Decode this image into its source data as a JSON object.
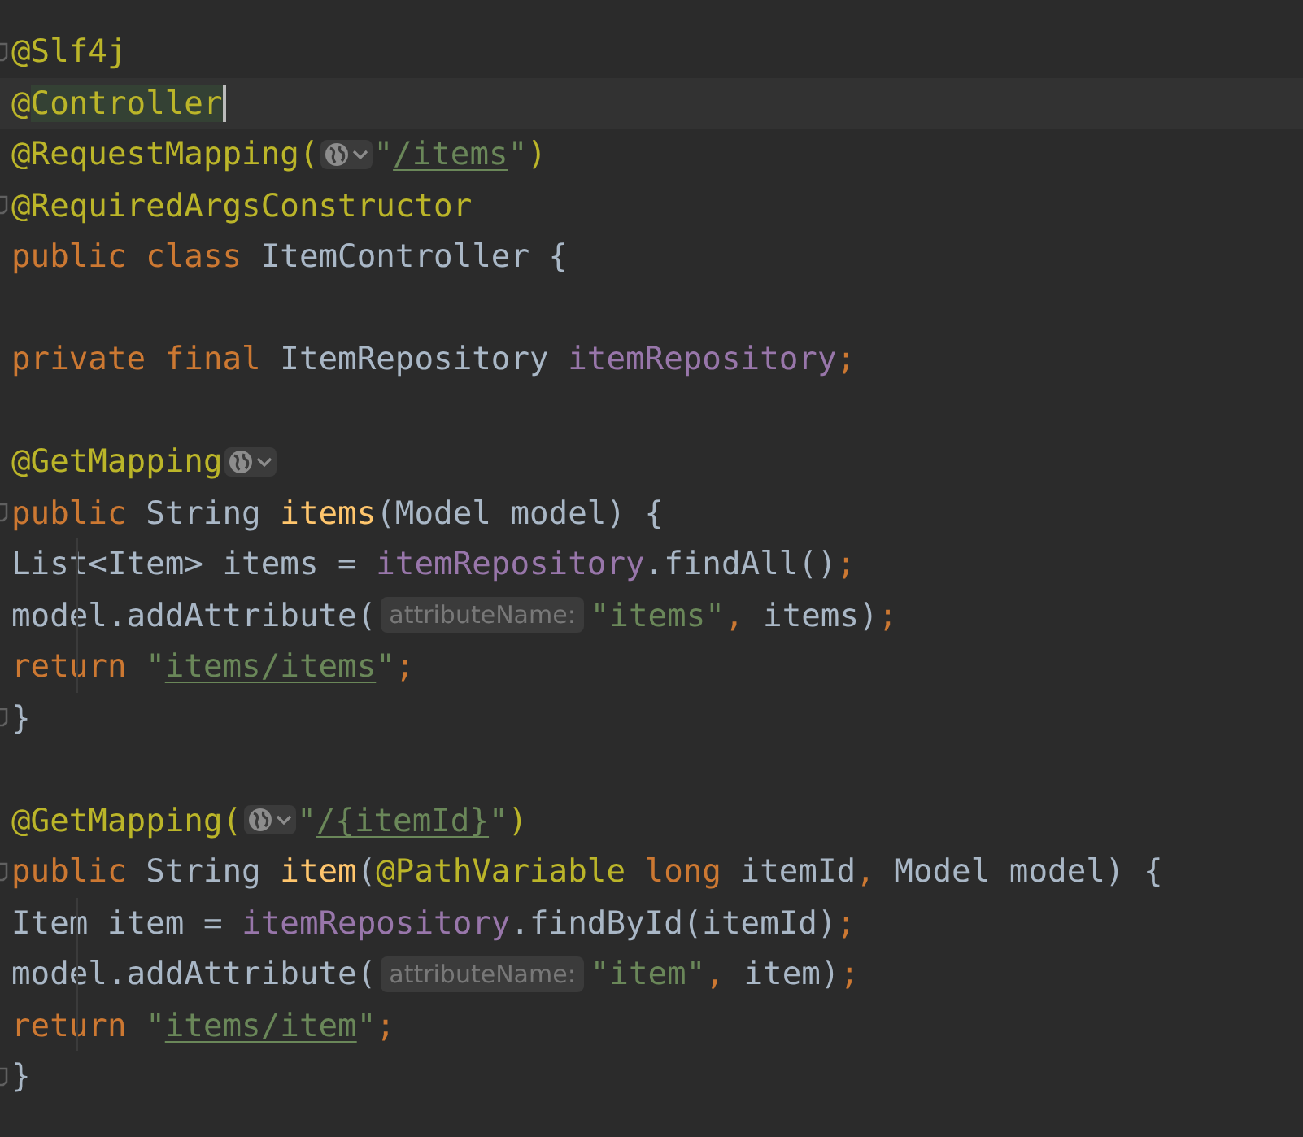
{
  "editor": {
    "lines": [
      {
        "current": false,
        "fold": true,
        "indent_guide": false,
        "segments": [
          {
            "kind": "code",
            "tokens": [
              {
                "t": "@Slf4j",
                "kind": "annotation"
              }
            ]
          }
        ]
      },
      {
        "current": true,
        "fold": false,
        "indent_guide": false,
        "segments": [
          {
            "kind": "code",
            "tokens": [
              {
                "t": "@",
                "kind": "annotation"
              },
              {
                "t": "Controller",
                "kind": "annotation",
                "highlighted": true
              }
            ]
          }
        ]
      },
      {
        "current": false,
        "fold": false,
        "indent_guide": false,
        "segments": [
          {
            "kind": "code",
            "tokens": [
              {
                "t": "@RequestMapping(",
                "kind": "annotation"
              }
            ]
          },
          {
            "kind": "globe"
          },
          {
            "kind": "code",
            "tokens": [
              {
                "t": "\"",
                "kind": "string"
              },
              {
                "t": "/items",
                "kind": "link"
              },
              {
                "t": "\"",
                "kind": "string"
              },
              {
                "t": ")",
                "kind": "annotation"
              }
            ]
          }
        ]
      },
      {
        "current": false,
        "fold": true,
        "indent_guide": false,
        "segments": [
          {
            "kind": "code",
            "tokens": [
              {
                "t": "@RequiredArgsConstructor",
                "kind": "annotation"
              }
            ]
          }
        ]
      },
      {
        "current": false,
        "fold": false,
        "indent_guide": false,
        "segments": [
          {
            "kind": "code",
            "tokens": [
              {
                "t": "public class ",
                "kind": "keyword"
              },
              {
                "t": "ItemController {",
                "kind": "plain"
              }
            ]
          }
        ]
      },
      {
        "current": false,
        "fold": false,
        "indent_guide": false
      },
      {
        "current": false,
        "fold": false,
        "indent_guide": false,
        "segments": [
          {
            "kind": "code",
            "tokens": [
              {
                "t": "    private final ",
                "kind": "keyword"
              },
              {
                "t": "ItemRepository ",
                "kind": "plain"
              },
              {
                "t": "itemRepository",
                "kind": "field"
              },
              {
                "t": ";",
                "kind": "punct"
              }
            ]
          }
        ]
      },
      {
        "current": false,
        "fold": false,
        "indent_guide": false
      },
      {
        "current": false,
        "fold": false,
        "indent_guide": false,
        "segments": [
          {
            "kind": "code",
            "tokens": [
              {
                "t": "    @GetMapping",
                "kind": "annotation"
              }
            ]
          },
          {
            "kind": "globe"
          }
        ]
      },
      {
        "current": false,
        "fold": true,
        "indent_guide": false,
        "segments": [
          {
            "kind": "code",
            "tokens": [
              {
                "t": "    public ",
                "kind": "keyword"
              },
              {
                "t": "String ",
                "kind": "plain"
              },
              {
                "t": "items",
                "kind": "method"
              },
              {
                "t": "(Model model) {",
                "kind": "plain"
              }
            ]
          }
        ]
      },
      {
        "current": false,
        "fold": false,
        "indent_guide": true,
        "segments": [
          {
            "kind": "code",
            "tokens": [
              {
                "t": "        List<Item> items = ",
                "kind": "plain"
              },
              {
                "t": "itemRepository",
                "kind": "field"
              },
              {
                "t": ".findAll()",
                "kind": "plain"
              },
              {
                "t": ";",
                "kind": "punct"
              }
            ]
          }
        ]
      },
      {
        "current": false,
        "fold": false,
        "indent_guide": true,
        "segments": [
          {
            "kind": "code",
            "tokens": [
              {
                "t": "        model.addAttribute(",
                "kind": "plain"
              }
            ]
          },
          {
            "kind": "hint",
            "text": "attributeName:"
          },
          {
            "kind": "code",
            "tokens": [
              {
                "t": "\"items\"",
                "kind": "string"
              },
              {
                "t": ", ",
                "kind": "punct"
              },
              {
                "t": "items)",
                "kind": "plain"
              },
              {
                "t": ";",
                "kind": "punct"
              }
            ]
          }
        ]
      },
      {
        "current": false,
        "fold": false,
        "indent_guide": true,
        "segments": [
          {
            "kind": "code",
            "tokens": [
              {
                "t": "        return ",
                "kind": "keyword"
              },
              {
                "t": "\"",
                "kind": "string"
              },
              {
                "t": "items/items",
                "kind": "link"
              },
              {
                "t": "\"",
                "kind": "string"
              },
              {
                "t": ";",
                "kind": "punct"
              }
            ]
          }
        ]
      },
      {
        "current": false,
        "fold": true,
        "indent_guide": false,
        "segments": [
          {
            "kind": "code",
            "tokens": [
              {
                "t": "    }",
                "kind": "plain"
              }
            ]
          }
        ]
      },
      {
        "current": false,
        "fold": false,
        "indent_guide": false
      },
      {
        "current": false,
        "fold": false,
        "indent_guide": false,
        "segments": [
          {
            "kind": "code",
            "tokens": [
              {
                "t": "    @GetMapping(",
                "kind": "annotation"
              }
            ]
          },
          {
            "kind": "globe"
          },
          {
            "kind": "code",
            "tokens": [
              {
                "t": "\"",
                "kind": "string"
              },
              {
                "t": "/{itemId}",
                "kind": "link"
              },
              {
                "t": "\"",
                "kind": "string"
              },
              {
                "t": ")",
                "kind": "annotation"
              }
            ]
          }
        ]
      },
      {
        "current": false,
        "fold": true,
        "indent_guide": false,
        "segments": [
          {
            "kind": "code",
            "tokens": [
              {
                "t": "    public ",
                "kind": "keyword"
              },
              {
                "t": "String ",
                "kind": "plain"
              },
              {
                "t": "item",
                "kind": "method"
              },
              {
                "t": "(",
                "kind": "plain"
              },
              {
                "t": "@PathVariable ",
                "kind": "annotation"
              },
              {
                "t": "long ",
                "kind": "keyword"
              },
              {
                "t": "itemId",
                "kind": "plain"
              },
              {
                "t": ", ",
                "kind": "punct"
              },
              {
                "t": "Model model) {",
                "kind": "plain"
              }
            ]
          }
        ]
      },
      {
        "current": false,
        "fold": false,
        "indent_guide": true,
        "segments": [
          {
            "kind": "code",
            "tokens": [
              {
                "t": "        Item item = ",
                "kind": "plain"
              },
              {
                "t": "itemRepository",
                "kind": "field"
              },
              {
                "t": ".findById(itemId)",
                "kind": "plain"
              },
              {
                "t": ";",
                "kind": "punct"
              }
            ]
          }
        ]
      },
      {
        "current": false,
        "fold": false,
        "indent_guide": true,
        "segments": [
          {
            "kind": "code",
            "tokens": [
              {
                "t": "        model.addAttribute(",
                "kind": "plain"
              }
            ]
          },
          {
            "kind": "hint",
            "text": "attributeName:"
          },
          {
            "kind": "code",
            "tokens": [
              {
                "t": "\"item\"",
                "kind": "string"
              },
              {
                "t": ", ",
                "kind": "punct"
              },
              {
                "t": "item)",
                "kind": "plain"
              },
              {
                "t": ";",
                "kind": "punct"
              }
            ]
          }
        ]
      },
      {
        "current": false,
        "fold": false,
        "indent_guide": true,
        "segments": [
          {
            "kind": "code",
            "tokens": [
              {
                "t": "        return ",
                "kind": "keyword"
              },
              {
                "t": "\"",
                "kind": "string"
              },
              {
                "t": "items/item",
                "kind": "link"
              },
              {
                "t": "\"",
                "kind": "string"
              },
              {
                "t": ";",
                "kind": "punct"
              }
            ]
          }
        ]
      },
      {
        "current": false,
        "fold": true,
        "indent_guide": false,
        "segments": [
          {
            "kind": "code",
            "tokens": [
              {
                "t": "    }",
                "kind": "plain"
              }
            ]
          }
        ]
      },
      {
        "current": false,
        "fold": false,
        "indent_guide": false
      }
    ]
  }
}
